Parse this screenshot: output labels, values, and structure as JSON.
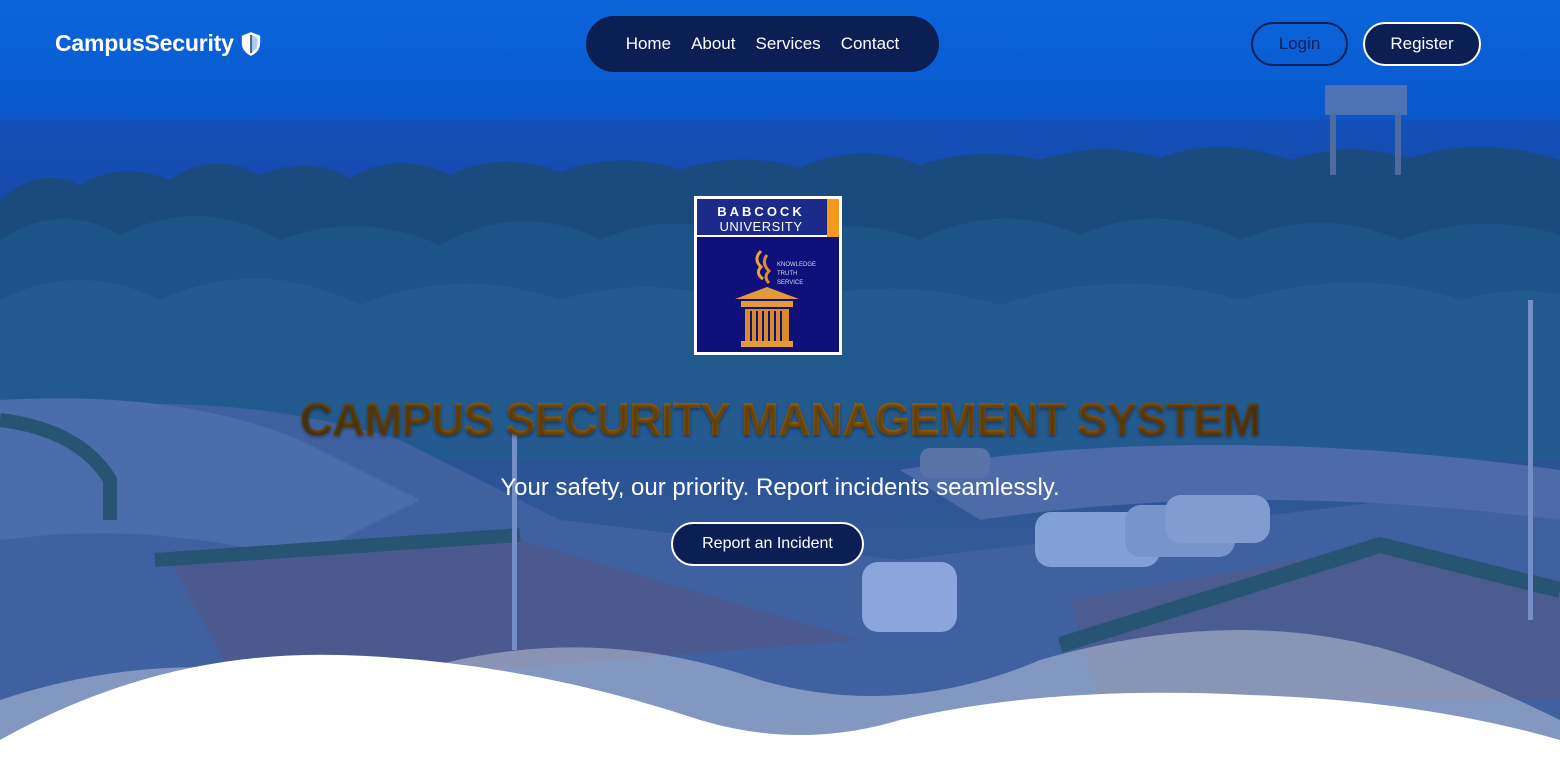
{
  "brand": {
    "name": "CampusSecurity",
    "icon": "shield-icon"
  },
  "nav": {
    "items": [
      {
        "label": "Home"
      },
      {
        "label": "About"
      },
      {
        "label": "Services"
      },
      {
        "label": "Contact"
      }
    ]
  },
  "auth": {
    "login_label": "Login",
    "register_label": "Register"
  },
  "logo": {
    "line1": "BABCOCK",
    "line2": "UNIVERSITY",
    "motto": [
      "KNOWLEDGE",
      "TRUTH",
      "SERVICE"
    ]
  },
  "hero": {
    "title": "CAMPUS SECURITY MANAGEMENT SYSTEM",
    "subtitle": "Your safety, our priority. Report incidents seamlessly.",
    "cta_label": "Report an Incident"
  },
  "colors": {
    "navy": "#0b1f55",
    "sky": "#0b6fe0",
    "gold": "#9a6512",
    "white": "#ffffff"
  }
}
